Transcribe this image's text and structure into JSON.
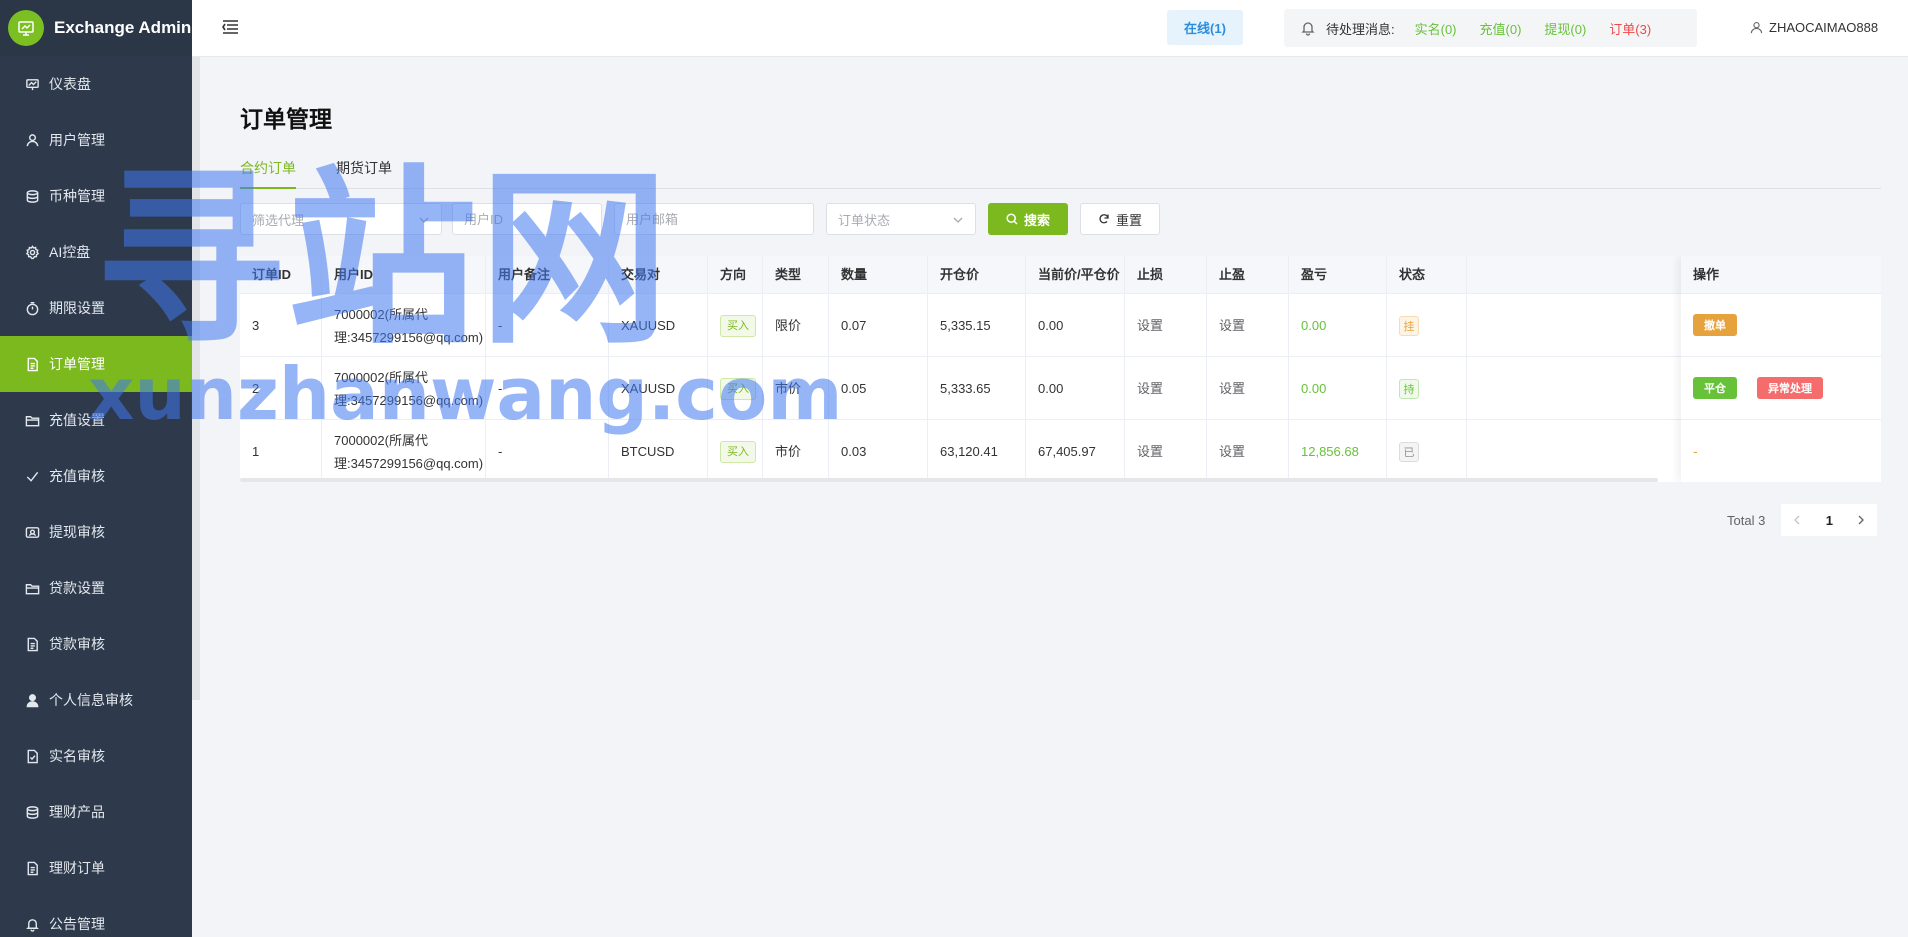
{
  "app": {
    "title": "Exchange Admin"
  },
  "sidebar": {
    "items": [
      {
        "label": "仪表盘",
        "icon": "dashboard-icon"
      },
      {
        "label": "用户管理",
        "icon": "user-icon"
      },
      {
        "label": "币种管理",
        "icon": "coins-icon"
      },
      {
        "label": "AI控盘",
        "icon": "gear-icon"
      },
      {
        "label": "期限设置",
        "icon": "timer-icon"
      },
      {
        "label": "订单管理",
        "icon": "document-icon",
        "active": true
      },
      {
        "label": "充值设置",
        "icon": "folder-icon"
      },
      {
        "label": "充值审核",
        "icon": "check-icon"
      },
      {
        "label": "提现审核",
        "icon": "wallet-icon"
      },
      {
        "label": "贷款设置",
        "icon": "folder-icon"
      },
      {
        "label": "贷款审核",
        "icon": "document-icon"
      },
      {
        "label": "个人信息审核",
        "icon": "person-icon"
      },
      {
        "label": "实名审核",
        "icon": "document-check-icon"
      },
      {
        "label": "理财产品",
        "icon": "coins-icon"
      },
      {
        "label": "理财订单",
        "icon": "document-icon"
      },
      {
        "label": "公告管理",
        "icon": "bell-icon"
      }
    ]
  },
  "header": {
    "online": "在线(1)",
    "pending_label": "待处理消息:",
    "pending": [
      {
        "label": "实名(0)",
        "color": "#67c23a"
      },
      {
        "label": "充值(0)",
        "color": "#67c23a"
      },
      {
        "label": "提现(0)",
        "color": "#67c23a"
      },
      {
        "label": "订单(3)",
        "color": "#f04848"
      }
    ],
    "username": "ZHAOCAIMAO888"
  },
  "page": {
    "title": "订单管理",
    "tabs": [
      "合约订单",
      "期货订单"
    ],
    "filters": {
      "agent_placeholder": "筛选代理",
      "userid_placeholder": "用户ID",
      "email_placeholder": "用户邮箱",
      "status_placeholder": "订单状态",
      "search_label": "搜索",
      "reset_label": "重置"
    }
  },
  "table": {
    "columns": [
      "订单ID",
      "用户ID",
      "用户备注",
      "交易对",
      "方向",
      "类型",
      "数量",
      "开仓价",
      "当前价/平仓价",
      "止损",
      "止盈",
      "盈亏",
      "状态",
      "操作"
    ],
    "rows": [
      {
        "id": "3",
        "user_line1": "7000002(所属代",
        "user_line2": "理:3457299156@qq.com)",
        "remark": "-",
        "pair": "XAUUSD",
        "direction": "买入",
        "type": "限价",
        "qty": "0.07",
        "open": "5,335.15",
        "current": "0.00",
        "sl": "设置",
        "tp": "设置",
        "pnl": "0.00",
        "status": "挂",
        "actions": [
          "撤单"
        ]
      },
      {
        "id": "2",
        "user_line1": "7000002(所属代",
        "user_line2": "理:3457299156@qq.com)",
        "remark": "-",
        "pair": "XAUUSD",
        "direction": "买入",
        "type": "市价",
        "qty": "0.05",
        "open": "5,333.65",
        "current": "0.00",
        "sl": "设置",
        "tp": "设置",
        "pnl": "0.00",
        "status": "持",
        "actions": [
          "平仓",
          "异常处理"
        ]
      },
      {
        "id": "1",
        "user_line1": "7000002(所属代",
        "user_line2": "理:3457299156@qq.com)",
        "remark": "-",
        "pair": "BTCUSD",
        "direction": "买入",
        "type": "市价",
        "qty": "0.03",
        "open": "63,120.41",
        "current": "67,405.97",
        "sl": "设置",
        "tp": "设置",
        "pnl": "12,856.68",
        "status": "已",
        "actions": [
          "-"
        ]
      }
    ]
  },
  "pagination": {
    "total": "Total 3",
    "current": "1"
  },
  "watermark": {
    "line1": "寻站网",
    "line2": "xunzhanwang.com"
  },
  "colors": {
    "accent": "#7cb91f",
    "sidebar": "#2e3a4b",
    "red": "#f56c6c",
    "orange": "#e6a23c",
    "green": "#67c23a"
  }
}
